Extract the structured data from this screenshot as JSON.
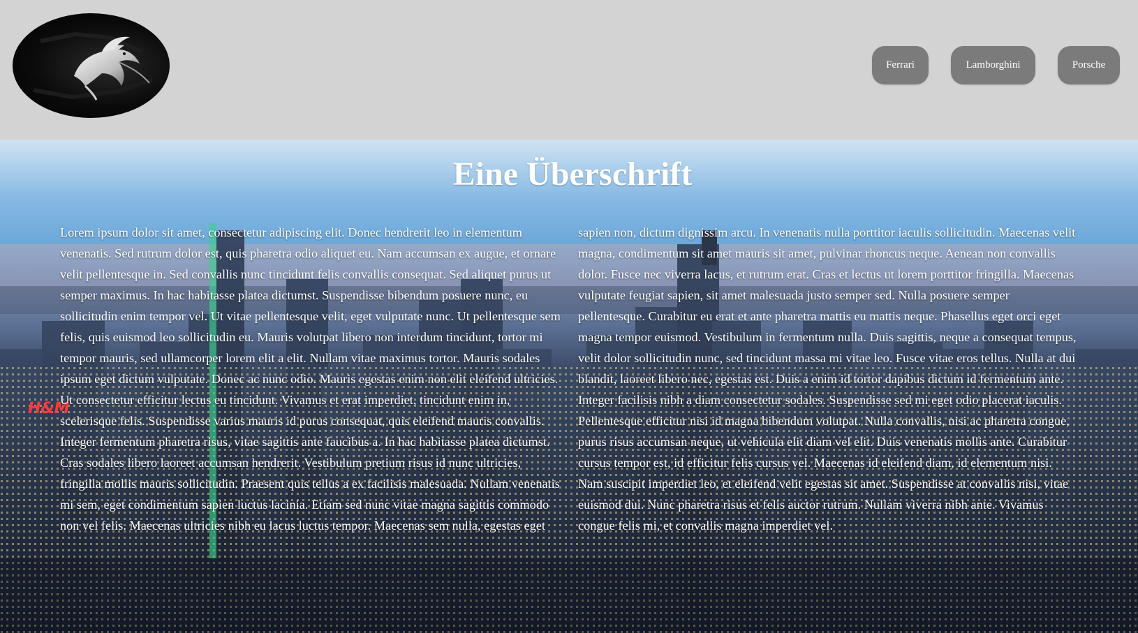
{
  "header": {
    "logo_icon": "horse-logo-icon",
    "nav": [
      {
        "label": "Ferrari"
      },
      {
        "label": "Lamborghini"
      },
      {
        "label": "Porsche"
      }
    ]
  },
  "hero": {
    "title": "Eine Überschrift",
    "background": "city-skyline-image",
    "text": "Lorem ipsum dolor sit amet, consectetur adipiscing elit. Donec hendrerit leo in elementum venenatis. Sed rutrum dolor est, quis pharetra odio aliquet eu. Nam accumsan ex augue, et ornare velit pellentesque in. Sed convallis nunc tincidunt felis convallis consequat. Sed aliquet purus ut semper maximus. In hac habitasse platea dictumst. Suspendisse bibendum posuere nunc, eu sollicitudin enim tempor vel. Ut vitae pellentesque velit, eget vulputate nunc. Ut pellentesque sem felis, quis euismod leo sollicitudin eu. Mauris volutpat libero non interdum tincidunt, tortor mi tempor mauris, sed ullamcorper lorem elit a elit. Nullam vitae maximus tortor. Mauris sodales ipsum eget dictum vulputate. Donec ac nunc odio. Mauris egestas enim non elit eleifend ultricies. Ut consectetur efficitur lectus eu tincidunt. Vivamus et erat imperdiet, tincidunt enim in, scelerisque felis. Suspendisse varius mauris id purus consequat, quis eleifend mauris convallis. Integer fermentum pharetra risus, vitae sagittis ante faucibus a. In hac habitasse platea dictumst. Cras sodales libero laoreet accumsan hendrerit. Vestibulum pretium risus id nunc ultricies, fringilla mollis mauris sollicitudin. Praesent quis tellus a ex facilisis malesuada. Nullam venenatis mi sem, eget condimentum sapien luctus lacinia. Etiam sed nunc vitae magna sagittis commodo non vel felis. Maecenas ultricies nibh eu lacus luctus tempor. Maecenas sem nulla, egestas eget sapien non, dictum dignissim arcu. In venenatis nulla porttitor iaculis sollicitudin. Maecenas velit magna, condimentum sit amet mauris sit amet, pulvinar rhoncus neque. Aenean non convallis dolor. Fusce nec viverra lacus, et rutrum erat. Cras et lectus ut lorem porttitor fringilla. Maecenas vulputate feugiat sapien, sit amet malesuada justo semper sed. Nulla posuere semper pellentesque. Curabitur eu erat et ante pharetra mattis eu mattis neque. Phasellus eget orci eget magna tempor euismod. Vestibulum in fermentum nulla. Duis sagittis, neque a consequat tempus, velit dolor sollicitudin nunc, sed tincidunt massa mi vitae leo. Fusce vitae eros tellus. Nulla at dui blandit, laoreet libero nec, egestas est. Duis a enim id tortor dapibus dictum id fermentum ante. Integer facilisis nibh a diam consectetur sodales. Suspendisse sed mi eget odio placerat iaculis. Pellentesque efficitur nisi id magna bibendum volutpat. Nulla convallis, nisi ac pharetra congue, purus risus accumsan neque, ut vehicula elit diam vel elit. Duis venenatis mollis ante. Curabitur cursus tempor est, id efficitur felis cursus vel. Maecenas id eleifend diam, id elementum nisi. Nam suscipit imperdiet leo, et eleifend velit egestas sit amet. Suspendisse at convallis nisi, vitae euismod dui. Nunc pharetra risus et felis auctor rutrum. Nullam viverra nibh ante. Vivamus congue felis mi, et convallis magna imperdiet vel."
  }
}
